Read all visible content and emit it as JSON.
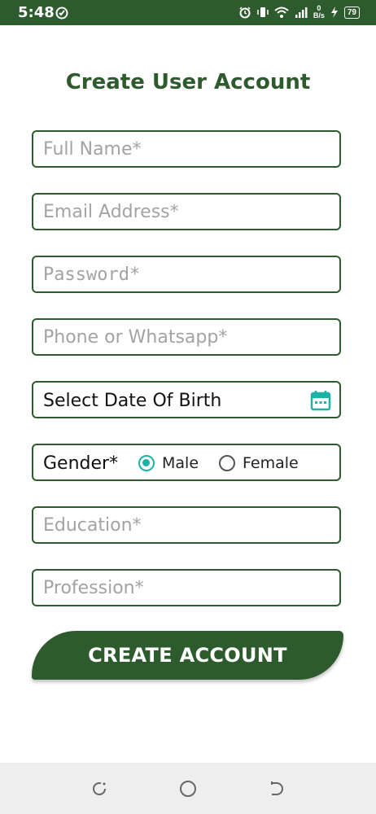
{
  "status_bar": {
    "time": "5:48",
    "battery": "79",
    "network_speed_value": "0",
    "network_speed_unit": "B/s",
    "icons": [
      "alarm-icon",
      "vibrate-icon",
      "wifi-icon",
      "signal-icon",
      "charging-icon",
      "battery-icon"
    ]
  },
  "form": {
    "title": "Create User Account",
    "full_name_placeholder": "Full Name*",
    "email_placeholder": "Email Address*",
    "password_placeholder": "Password*",
    "phone_placeholder": "Phone or Whatsapp*",
    "dob_label": "Select Date Of Birth",
    "gender_label": "Gender*",
    "gender_options": [
      {
        "label": "Male",
        "selected": true
      },
      {
        "label": "Female",
        "selected": false
      }
    ],
    "education_placeholder": "Education*",
    "profession_placeholder": "Profession*",
    "submit_label": "CREATE ACCOUNT"
  },
  "colors": {
    "primary": "#2e5b2d",
    "accent": "#1ab3a6",
    "placeholder": "#a3a3a3",
    "nav_bar": "#eeeeee"
  },
  "nav_bar": {
    "buttons": [
      "recent-apps-icon",
      "home-icon",
      "back-icon"
    ]
  }
}
